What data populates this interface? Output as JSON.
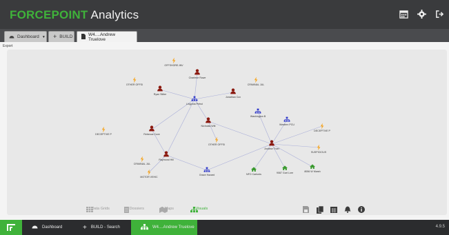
{
  "header": {
    "brand_highlight": "FORCEPOINT",
    "brand_rest": " Analytics",
    "icons": [
      "calendar-icon",
      "gear-icon",
      "logout-icon"
    ]
  },
  "tabs": [
    {
      "label": "Dashboard",
      "icon": "dashboard-icon"
    },
    {
      "label": "BUILD",
      "icon": "plus-icon"
    },
    {
      "label": "W4....Andrew Truelove",
      "icon": "document-icon"
    }
  ],
  "content": {
    "export_label": "Export"
  },
  "graph": {
    "nodes": [
      {
        "label": "OFFSHORE-INV",
        "type": "alert"
      },
      {
        "label": "Charlene Rowe",
        "type": "person"
      },
      {
        "label": "OTHER OFFSI",
        "type": "alert"
      },
      {
        "label": "Ryan Stilter",
        "type": "person"
      },
      {
        "label": "CRIMINAL JUL",
        "type": "alert"
      },
      {
        "label": "Jonathan Cox",
        "type": "person"
      },
      {
        "label": "Lingonia Petrol",
        "type": "org"
      },
      {
        "label": "Washington B",
        "type": "org"
      },
      {
        "label": "Western PCU",
        "type": "org"
      },
      {
        "label": "Nicholas Witt",
        "type": "person"
      },
      {
        "label": "DECEPTIVE P",
        "type": "alert"
      },
      {
        "label": "DECEPTIVE P",
        "type": "alert"
      },
      {
        "label": "Rebecca Cove",
        "type": "person"
      },
      {
        "label": "OTHER OFFSI",
        "type": "alert"
      },
      {
        "label": "Andrew Truel",
        "type": "person"
      },
      {
        "label": "SUSPICIOUS",
        "type": "alert"
      },
      {
        "label": "CRIMINAL JUL",
        "type": "alert"
      },
      {
        "label": "Raymond Hill",
        "type": "person"
      },
      {
        "label": "Grace Hazard",
        "type": "org"
      },
      {
        "label": "MOTOR VEHIC",
        "type": "alert"
      },
      {
        "label": "NFO Cartonis",
        "type": "device"
      },
      {
        "label": "9087 Gart Lore",
        "type": "device"
      },
      {
        "label": "8056 W Marsh",
        "type": "device"
      }
    ]
  },
  "bottombar": {
    "items": [
      {
        "label": "0 Data Grids",
        "icon": "grid-icon"
      },
      {
        "label": "0 Dossiers",
        "icon": "dossier-icon"
      },
      {
        "label": "0 Maps",
        "icon": "map-icon"
      },
      {
        "label": "1 Visuals",
        "icon": "visuals-icon"
      }
    ],
    "right_icons": [
      "save-icon",
      "copy-icon",
      "calendar-icon",
      "bell-icon",
      "info-icon"
    ]
  },
  "footer": {
    "segments": [
      {
        "label": "Dashboard",
        "icon": "dashboard-icon"
      },
      {
        "label": "BUILD - Search",
        "icon": "plus-icon"
      },
      {
        "label": "W4....Andrew Truelove",
        "icon": "network-icon"
      }
    ],
    "version": "4.9.5"
  },
  "colors": {
    "accent": "#3fb23a",
    "person": "#8b1a10",
    "org": "#2f39c9",
    "alert": "#f5a623",
    "device": "#3a9a2f"
  }
}
